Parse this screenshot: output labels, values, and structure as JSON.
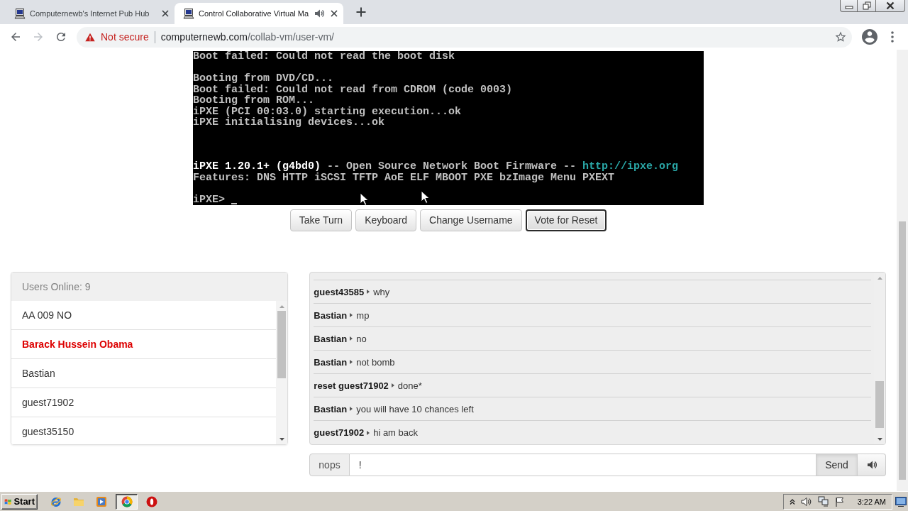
{
  "browser": {
    "tabs": [
      {
        "title": "Computernewb's Internet Pub Hub",
        "selected": false,
        "audible": false
      },
      {
        "title": "Control Collaborative Virtual Ma",
        "selected": true,
        "audible": true
      }
    ],
    "navigation": {
      "back_disabled": false,
      "forward_disabled": true
    },
    "security_label": "Not secure",
    "url": {
      "host": "computernewb.com",
      "path": "/collab-vm/user-vm/"
    },
    "bookmarked": false
  },
  "vm_screen": {
    "lines": [
      {
        "kind": "text",
        "spans": [
          {
            "text": "Boot failed: Could not read the boot disk",
            "kind": "normal"
          }
        ]
      },
      {
        "kind": "blank"
      },
      {
        "kind": "text",
        "spans": [
          {
            "text": "Booting from DVD/CD...",
            "kind": "normal"
          }
        ]
      },
      {
        "kind": "text",
        "spans": [
          {
            "text": "Boot failed: Could not read from CDROM (code 0003)",
            "kind": "normal"
          }
        ]
      },
      {
        "kind": "text",
        "spans": [
          {
            "text": "Booting from ROM...",
            "kind": "normal"
          }
        ]
      },
      {
        "kind": "text",
        "spans": [
          {
            "text": "iPXE (PCI 00:03.0) starting execution...ok",
            "kind": "normal"
          }
        ]
      },
      {
        "kind": "text",
        "spans": [
          {
            "text": "iPXE initialising devices...ok",
            "kind": "normal"
          }
        ]
      },
      {
        "kind": "blank"
      },
      {
        "kind": "blank"
      },
      {
        "kind": "blank"
      },
      {
        "kind": "text",
        "spans": [
          {
            "text": "iPXE 1.20.1+ (g4bd0)",
            "kind": "bright"
          },
          {
            "text": " -- Open Source Network Boot Firmware -- ",
            "kind": "normal"
          },
          {
            "text": "http://ipxe.org",
            "kind": "link"
          }
        ]
      },
      {
        "kind": "text",
        "spans": [
          {
            "text": "Features: DNS HTTP iSCSI TFTP AoE ELF MBOOT PXE bzImage Menu PXEXT",
            "kind": "normal"
          }
        ]
      },
      {
        "kind": "blank"
      },
      {
        "kind": "prompt",
        "spans": [
          {
            "text": "iPXE>",
            "kind": "normal"
          }
        ]
      }
    ]
  },
  "vm_buttons": [
    {
      "label": "Take Turn",
      "focused": false
    },
    {
      "label": "Keyboard",
      "focused": false
    },
    {
      "label": "Change Username",
      "focused": false
    },
    {
      "label": "Vote for Reset",
      "focused": true
    }
  ],
  "users_panel": {
    "heading": "Users Online: 9",
    "users": [
      {
        "name": "AA 009 NO",
        "highlighted": false
      },
      {
        "name": "Barack Hussein Obama",
        "highlighted": true
      },
      {
        "name": "Bastian",
        "highlighted": false
      },
      {
        "name": "guest71902",
        "highlighted": false
      },
      {
        "name": "guest35150",
        "highlighted": false
      }
    ]
  },
  "chat": {
    "messages": [
      {
        "user": "guest43585",
        "text": "why"
      },
      {
        "user": "Bastian",
        "text": "mp"
      },
      {
        "user": "Bastian",
        "text": "no"
      },
      {
        "user": "Bastian",
        "text": "not bomb"
      },
      {
        "user": "reset guest71902",
        "text": "done*"
      },
      {
        "user": "Bastian",
        "text": "you will have 10 chances left"
      },
      {
        "user": "guest71902",
        "text": "hi am back"
      }
    ],
    "input": {
      "username": "nops",
      "value": "!"
    },
    "send_label": "Send"
  },
  "taskbar": {
    "start_label": "Start",
    "pinned": [
      {
        "selected": false
      },
      {
        "selected": false
      },
      {
        "selected": false
      },
      {
        "selected": true
      },
      {
        "selected": false
      }
    ],
    "clock": "3:22 AM"
  }
}
